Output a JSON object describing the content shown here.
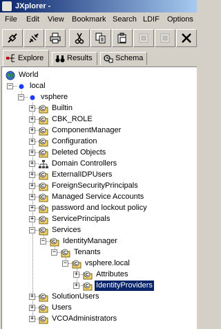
{
  "window": {
    "title": "JXplorer -"
  },
  "menu": [
    "File",
    "Edit",
    "View",
    "Bookmark",
    "Search",
    "LDIF",
    "Options"
  ],
  "toolbar": [
    {
      "icon": "connect-icon",
      "disabled": false
    },
    {
      "icon": "disconnect-icon",
      "disabled": false
    },
    {
      "icon": "print-icon",
      "disabled": false
    },
    {
      "icon": "cut-icon",
      "disabled": false
    },
    {
      "icon": "copy-icon",
      "disabled": false
    },
    {
      "icon": "copy-dn-icon",
      "disabled": false
    },
    {
      "icon": "paste-icon",
      "disabled": true
    },
    {
      "icon": "paste-alias-icon",
      "disabled": true
    },
    {
      "icon": "delete-icon",
      "disabled": false
    }
  ],
  "tabs": [
    {
      "label": "Explore",
      "icon": "explore-icon",
      "active": true
    },
    {
      "label": "Results",
      "icon": "binoculars-icon",
      "active": false
    },
    {
      "label": "Schema",
      "icon": "schema-icon",
      "active": false
    }
  ],
  "tree": [
    {
      "label": "World",
      "icon": "globe-icon",
      "level": 0,
      "expander": "none"
    },
    {
      "label": "local",
      "icon": "dot-icon",
      "level": 1,
      "expander": "minus"
    },
    {
      "label": "vsphere",
      "icon": "dot-icon",
      "level": 2,
      "expander": "minus"
    },
    {
      "label": "Builtin",
      "icon": "container-icon",
      "level": 3,
      "expander": "plus"
    },
    {
      "label": "CBK_ROLE",
      "icon": "container-icon",
      "level": 3,
      "expander": "plus"
    },
    {
      "label": "ComponentManager",
      "icon": "container-icon",
      "level": 3,
      "expander": "plus"
    },
    {
      "label": "Configuration",
      "icon": "container-icon",
      "level": 3,
      "expander": "plus"
    },
    {
      "label": "Deleted Objects",
      "icon": "container-icon",
      "level": 3,
      "expander": "plus"
    },
    {
      "label": "Domain Controllers",
      "icon": "network-icon",
      "level": 3,
      "expander": "plus"
    },
    {
      "label": "ExternalIDPUsers",
      "icon": "container-icon",
      "level": 3,
      "expander": "plus"
    },
    {
      "label": "ForeignSecurityPrincipals",
      "icon": "container-icon",
      "level": 3,
      "expander": "plus"
    },
    {
      "label": "Managed Service Accounts",
      "icon": "container-icon",
      "level": 3,
      "expander": "plus"
    },
    {
      "label": "password and lockout policy",
      "icon": "container-icon",
      "level": 3,
      "expander": "plus"
    },
    {
      "label": "ServicePrincipals",
      "icon": "container-icon",
      "level": 3,
      "expander": "plus"
    },
    {
      "label": "Services",
      "icon": "container-icon",
      "level": 3,
      "expander": "minus"
    },
    {
      "label": "IdentityManager",
      "icon": "container-icon",
      "level": 4,
      "expander": "minus"
    },
    {
      "label": "Tenants",
      "icon": "container-icon",
      "level": 5,
      "expander": "minus"
    },
    {
      "label": "vsphere.local",
      "icon": "container-icon",
      "level": 6,
      "expander": "minus"
    },
    {
      "label": "Attributes",
      "icon": "container-icon",
      "level": 7,
      "expander": "plus"
    },
    {
      "label": "IdentityProviders",
      "icon": "container-icon",
      "level": 7,
      "expander": "plus",
      "selected": true
    },
    {
      "label": "SolutionUsers",
      "icon": "container-icon",
      "level": 3,
      "expander": "plus"
    },
    {
      "label": "Users",
      "icon": "container-icon",
      "level": 3,
      "expander": "plus"
    },
    {
      "label": "VCOAdministrators",
      "icon": "container-icon",
      "level": 3,
      "expander": "plus"
    }
  ]
}
